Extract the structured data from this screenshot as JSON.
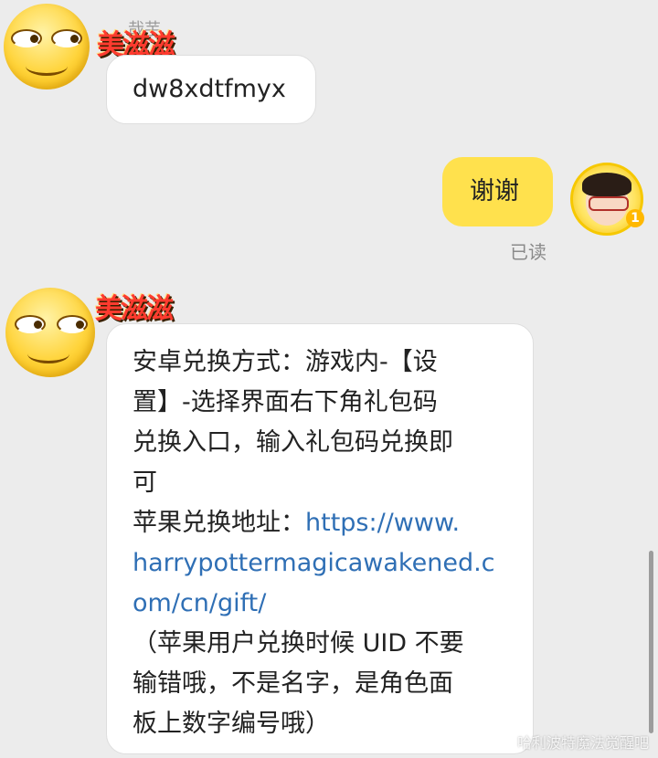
{
  "messages": [
    {
      "sender": "美滋滋",
      "sender_ghost": "哉芋",
      "text": "dw8xdtfmyx"
    },
    {
      "sender": "me",
      "text": "谢谢",
      "read_status": "已读"
    },
    {
      "sender": "美滋滋",
      "lines": {
        "l1": "安卓兑换方式：游戏内-【设",
        "l2": "置】-选择界面右下角礼包码",
        "l3": "兑换入口，输入礼包码兑换即",
        "l4": "可",
        "l5_prefix": "苹果兑换地址：",
        "l5_link": "https://www.",
        "l6_link": "harrypottermagicawakened.c",
        "l7_link": "om/cn/gift/",
        "l8": "（苹果用户兑换时候 UID 不要",
        "l9": "输错哦，不是名字，是角色面",
        "l10": "板上数字编号哦）"
      }
    }
  ],
  "me_avatar_badge": "1",
  "watermark": "哈利波特魔法觉醒吧",
  "colors": {
    "background": "#ececec",
    "bubble_self": "#ffe14d",
    "bubble_other": "#ffffff",
    "link": "#2f6fb5",
    "name": "#ff3b2f"
  }
}
